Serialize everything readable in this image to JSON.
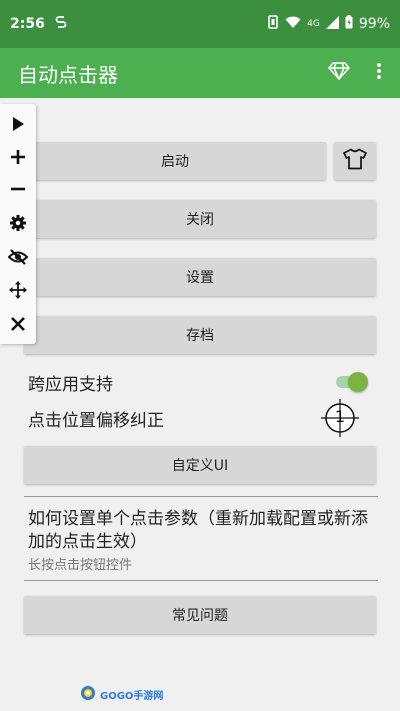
{
  "status_bar": {
    "time": "2:56",
    "network": "4G",
    "battery": "99%"
  },
  "app_bar": {
    "title": "自动点击器",
    "icons": [
      "diamond-icon",
      "more-vert-icon"
    ]
  },
  "floating_toolbar": {
    "icons": [
      "play-icon",
      "plus-icon",
      "minus-icon",
      "gear-icon",
      "eye-off-icon",
      "move-icon",
      "close-icon"
    ]
  },
  "buttons": {
    "start": "启动",
    "close": "关闭",
    "settings": "设置",
    "archive": "存档",
    "custom_ui": "自定义UI",
    "faq": "常见问题"
  },
  "options": {
    "cross_app_label": "跨应用支持",
    "cross_app_enabled": true,
    "offset_label": "点击位置偏移纠正",
    "offset_marker": "1"
  },
  "help": {
    "title": "如何设置单个点击参数（重新加载配置或新添加的点击生效）",
    "subtitle": "长按点击按钮控件"
  },
  "watermark": {
    "text": "GOGO手游网"
  },
  "colors": {
    "status_bar": "#3c8f3e",
    "app_bar": "#4caf50",
    "button": "#d7d7d7",
    "switch_on": "#7cb342"
  }
}
